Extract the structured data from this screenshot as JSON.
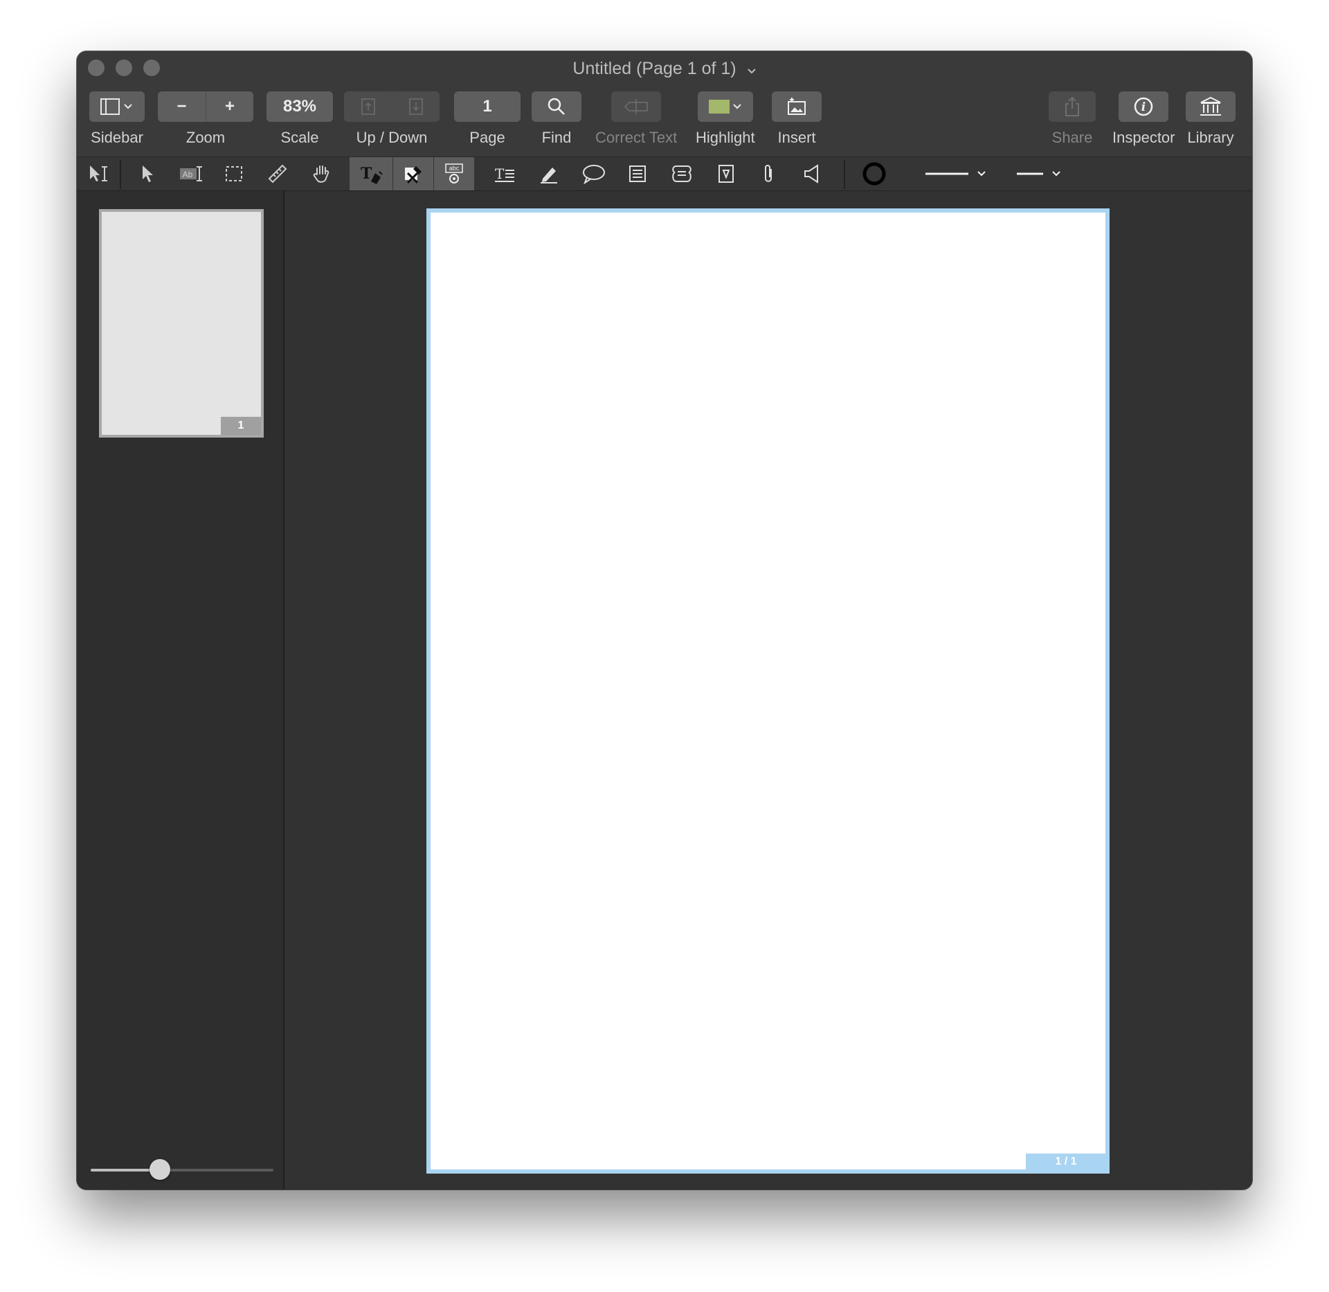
{
  "window": {
    "title": "Untitled (Page 1 of 1)"
  },
  "toolbar": {
    "sidebar_label": "Sidebar",
    "zoom_out": "−",
    "zoom_in": "+",
    "zoom_label": "Zoom",
    "scale_value": "83%",
    "scale_label": "Scale",
    "updown_label": "Up / Down",
    "page_value": "1",
    "page_label": "Page",
    "find_label": "Find",
    "correct_text_label": "Correct Text",
    "highlight_label": "Highlight",
    "highlight_color": "#a3b86a",
    "insert_label": "Insert",
    "share_label": "Share",
    "inspector_label": "Inspector",
    "library_label": "Library"
  },
  "tools": [
    "smart-selection-icon",
    "arrow-pointer-icon",
    "text-selection-icon",
    "rectangle-selection-icon",
    "ruler-icon",
    "hand-icon",
    "typewriter-icon",
    "redact-icon",
    "spellcheck-icon",
    "text-box-icon",
    "pen-icon",
    "speech-bubble-icon",
    "note-icon",
    "cloud-shape-icon",
    "stamp-icon",
    "paperclip-icon",
    "speaker-icon"
  ],
  "sidebar": {
    "thumbnail_number": "1",
    "thumb_size": 0.38
  },
  "document": {
    "page_tag": "1 / 1"
  }
}
